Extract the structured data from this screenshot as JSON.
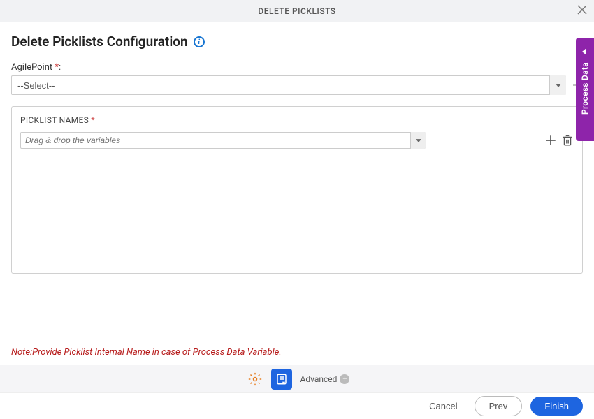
{
  "header": {
    "title": "DELETE PICKLISTS"
  },
  "page": {
    "title": "Delete Picklists Configuration"
  },
  "fields": {
    "agilepoint": {
      "label": "AgilePoint",
      "required_marker": "*",
      "selected": "--Select--"
    }
  },
  "panel": {
    "title": "PICKLIST NAMES",
    "required_marker": "*",
    "variable_placeholder": "Drag & drop the variables"
  },
  "note": "Note:Provide Picklist Internal Name in case of Process Data Variable.",
  "toolbar": {
    "advanced_label": "Advanced"
  },
  "footer": {
    "cancel": "Cancel",
    "prev": "Prev",
    "finish": "Finish"
  },
  "sidebar": {
    "process_data": "Process Data"
  }
}
